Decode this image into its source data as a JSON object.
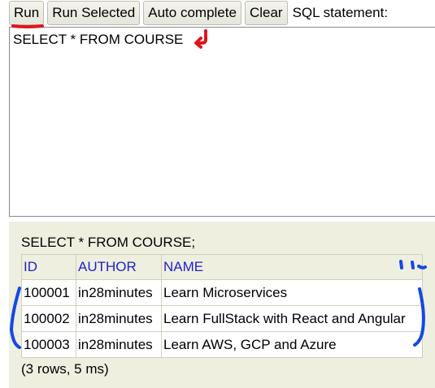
{
  "toolbar": {
    "run_label": "Run",
    "run_selected_label": "Run Selected",
    "auto_complete_label": "Auto complete",
    "clear_label": "Clear",
    "sql_statement_label": "SQL statement:"
  },
  "editor": {
    "value": "SELECT * FROM COURSE"
  },
  "result": {
    "query_text": "SELECT * FROM COURSE;",
    "columns": [
      "ID",
      "AUTHOR",
      "NAME"
    ],
    "rows": [
      [
        "100001",
        "in28minutes",
        "Learn Microservices"
      ],
      [
        "100002",
        "in28minutes",
        "Learn FullStack with React and Angular"
      ],
      [
        "100003",
        "in28minutes",
        "Learn AWS, GCP and Azure"
      ]
    ],
    "status": "(3 rows, 5 ms)"
  },
  "colors": {
    "panel_background": "#efefe0",
    "header_link": "#1f1fd0",
    "annotation_red": "#e0141e",
    "annotation_blue": "#1448e6"
  }
}
